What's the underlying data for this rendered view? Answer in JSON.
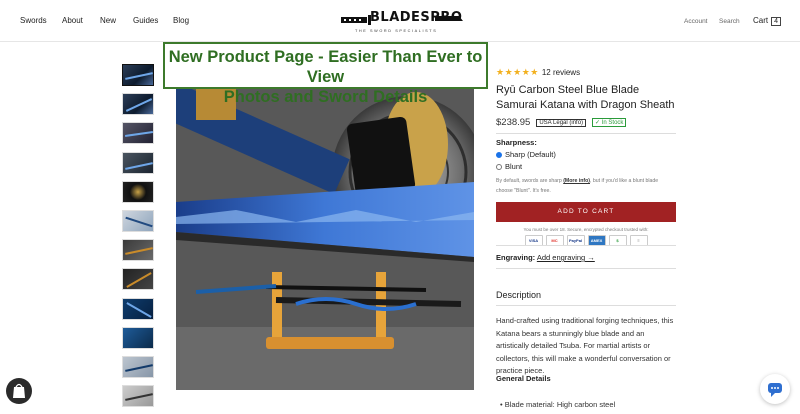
{
  "nav": {
    "left": [
      "Swords",
      "About",
      "New",
      "Guides",
      "Blog"
    ],
    "right": {
      "account": "Account",
      "search": "Search",
      "cart": "Cart",
      "cart_count": "4"
    }
  },
  "logo": {
    "name": "BLADESPRO",
    "tagline": "THE SWORD SPECIALISTS"
  },
  "banner": {
    "line1": "New Product Page - Easier Than Ever to View",
    "line2": "Photos and Sword Details"
  },
  "product": {
    "rating_stars": "★★★★★",
    "reviews": "12 reviews",
    "title": "Ryū Carbon Steel Blue Blade Samurai Katana with Dragon Sheath",
    "price": "$238.95",
    "badge_legal": "USA Legal (info)",
    "badge_stock": "✓ In Stock",
    "sharpness_label": "Sharpness:",
    "options": [
      "Sharp (Default)",
      "Blunt"
    ],
    "note_pre": "By default, swords are sharp",
    "note_link": "(More info)",
    "note_post": ", but if you'd like a blunt blade choose \"Blunt\". It's free.",
    "add_to_cart": "ADD TO CART",
    "secure_text": "You must be over 18. Secure, encrypted checkout trusted with:",
    "payments": [
      "VISA",
      "MC",
      "PayPal",
      "AMEX",
      "$",
      "≡"
    ],
    "engraving_label": "Engraving:",
    "engraving_link": "Add engraving →",
    "description_heading": "Description",
    "description": "Hand-crafted using traditional forging techniques, this Katana bears a stunningly blue blade and an artistically detailed Tsuba. For martial artists or collectors, this will make a wonderful conversation or practice piece.",
    "general_heading": "General Details",
    "bullet1": "Blade material: High carbon steel"
  },
  "colors": {
    "accent": "#a12223",
    "banner_green": "#2f6e22",
    "star": "#f2b01e"
  }
}
